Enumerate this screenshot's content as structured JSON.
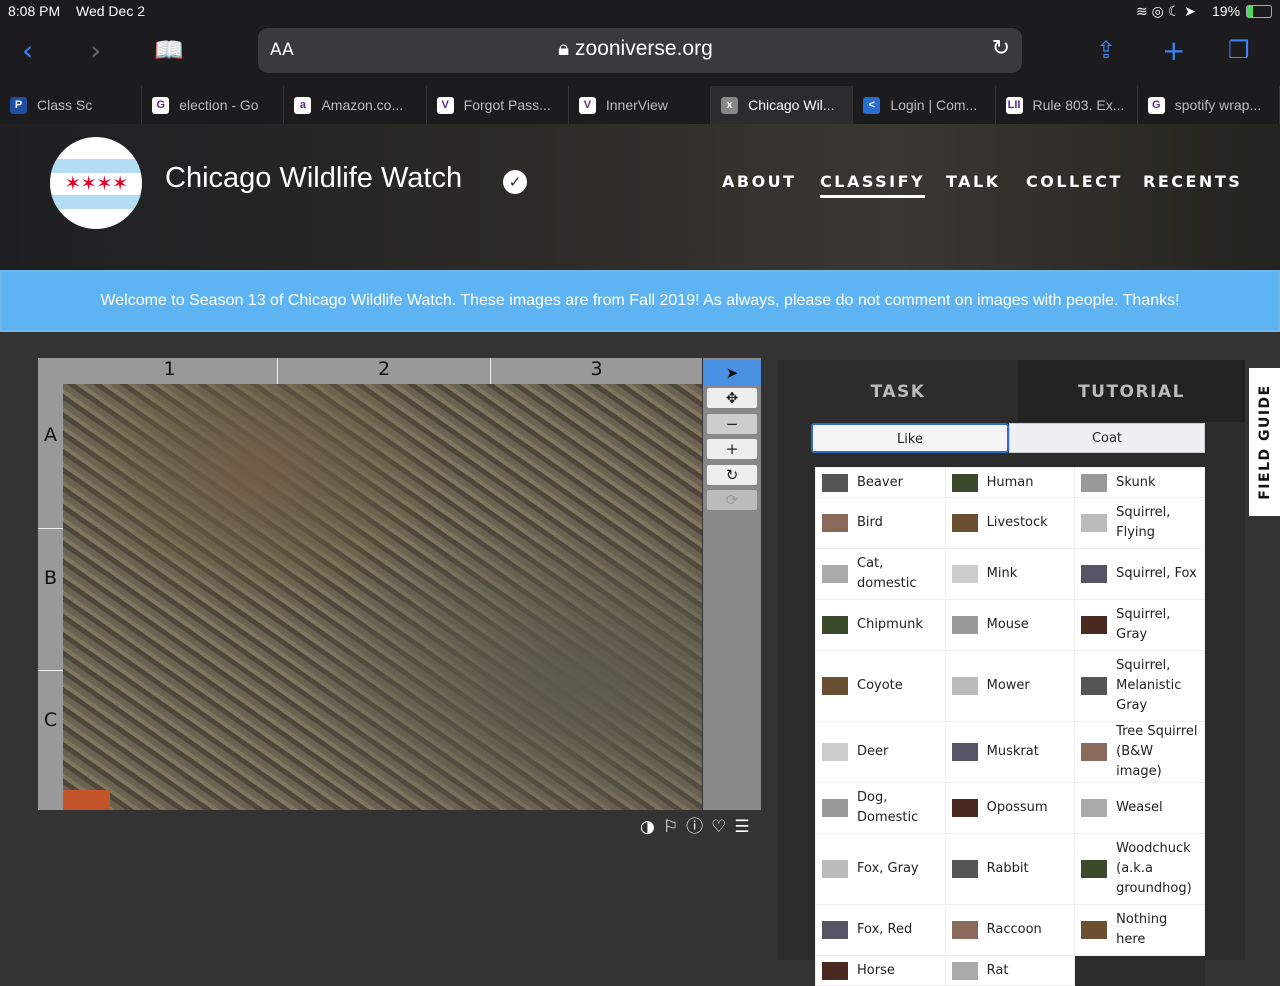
{
  "status": {
    "time": "8:08 PM",
    "date": "Wed Dec 2",
    "battery": "19%"
  },
  "browser": {
    "text_size": "AA",
    "url": "zooniverse.org"
  },
  "tabs": [
    {
      "label": "Class Sc",
      "icon": "P",
      "color": "#1e4fa0"
    },
    {
      "label": "election - Go",
      "icon": "G",
      "color": "#fff"
    },
    {
      "label": "Amazon.co...",
      "icon": "a",
      "color": "#fff"
    },
    {
      "label": "Forgot Pass...",
      "icon": "V",
      "color": "#fff"
    },
    {
      "label": "InnerView",
      "icon": "V",
      "color": "#fff"
    },
    {
      "label": "Chicago Wil...",
      "icon": "x",
      "color": "#888",
      "active": true
    },
    {
      "label": "Login | Com...",
      "icon": "<",
      "color": "#2a6fd0"
    },
    {
      "label": "Rule 803. Ex...",
      "icon": "LII",
      "color": "#fff"
    },
    {
      "label": "spotify wrap...",
      "icon": "G",
      "color": "#fff"
    }
  ],
  "site": {
    "title": "Chicago Wildlife Watch",
    "nav": [
      "ABOUT",
      "CLASSIFY",
      "TALK",
      "COLLECT",
      "RECENTS"
    ],
    "active_nav": "CLASSIFY"
  },
  "banner": "Welcome to Season 13 of Chicago Wildlife Watch. These images are from Fall 2019! As always, please do not comment on images with people. Thanks!",
  "viewer": {
    "columns": [
      "1",
      "2",
      "3"
    ],
    "rows": [
      "A",
      "B",
      "C"
    ]
  },
  "panel": {
    "tabs": [
      "TASK",
      "TUTORIAL"
    ],
    "filters": [
      "Like",
      "Coat"
    ],
    "field_guide": "FIELD GUIDE",
    "choices": [
      [
        "Beaver",
        "Human",
        "Skunk"
      ],
      [
        "Bird",
        "Livestock",
        "Squirrel, Flying"
      ],
      [
        "Cat, domestic",
        "Mink",
        "Squirrel, Fox"
      ],
      [
        "Chipmunk",
        "Mouse",
        "Squirrel, Gray"
      ],
      [
        "Coyote",
        "Mower",
        "Squirrel, Melanistic Gray"
      ],
      [
        "Deer",
        "Muskrat",
        "Tree Squirrel (B&W image)"
      ],
      [
        "Dog, Domestic",
        "Opossum",
        "Weasel"
      ],
      [
        "Fox, Gray",
        "Rabbit",
        "Woodchuck (a.k.a groundhog)"
      ],
      [
        "Fox, Red",
        "Raccoon",
        "Nothing here"
      ],
      [
        "Horse",
        "Rat",
        ""
      ]
    ]
  }
}
